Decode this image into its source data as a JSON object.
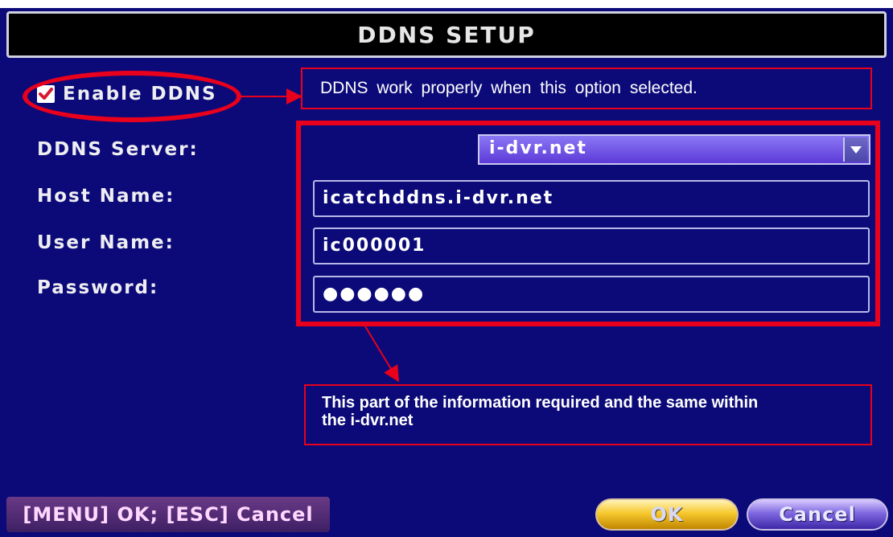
{
  "window": {
    "title": "DDNS SETUP"
  },
  "enable": {
    "label": "Enable DDNS",
    "checked": true
  },
  "annotations": {
    "enable_note": "DDNS work properly when this option selected.",
    "fields_note": "This part of the information required and the same within the i-dvr.net",
    "highlight_color": "#e8001c"
  },
  "form": {
    "server_label": "DDNS Server:",
    "server_value": "i-dvr.net",
    "host_label": "Host Name:",
    "host_value": "icatchddns.i-dvr.net",
    "user_label": "User Name:",
    "user_value": "ic000001",
    "password_label": "Password:",
    "password_value": "●●●●●●"
  },
  "footer": {
    "hint": "[MENU] OK; [ESC] Cancel",
    "ok_label": "OK",
    "cancel_label": "Cancel"
  },
  "colors": {
    "background": "#0c0a78",
    "title_bar": "#000000",
    "ok_button": "#f7c92f",
    "cancel_button": "#7f68e0",
    "select_bg": "#6a50e6"
  },
  "icons": {
    "checkbox": "checkmark-icon",
    "dropdown": "triangle-down-icon"
  }
}
